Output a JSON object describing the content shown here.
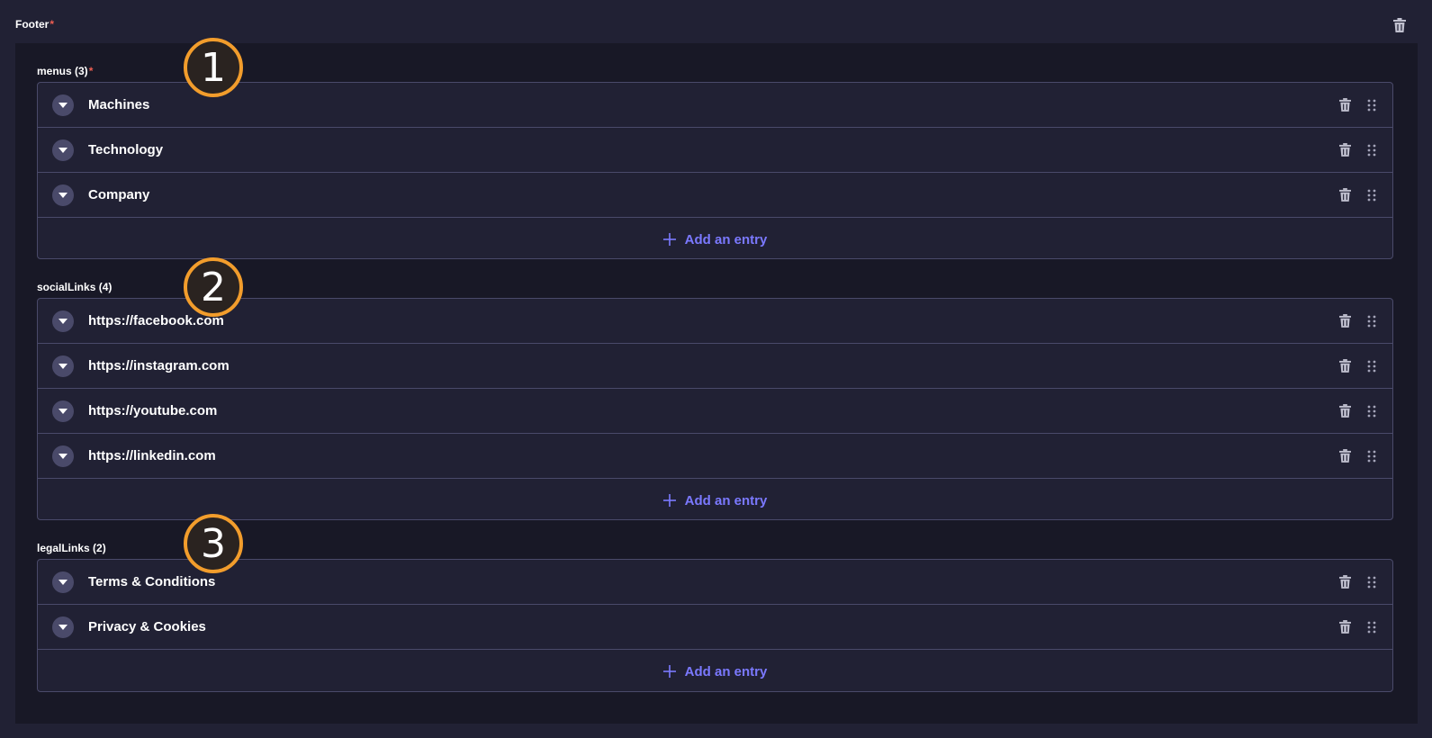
{
  "header": {
    "title": "Footer",
    "required_mark": "*"
  },
  "sections": [
    {
      "label": "menus (3)",
      "required_mark": "*",
      "items": [
        "Machines",
        "Technology",
        "Company"
      ],
      "add_label": "Add an entry"
    },
    {
      "label": "socialLinks (4)",
      "required_mark": "",
      "items": [
        "https://facebook.com",
        "https://instagram.com",
        "https://youtube.com",
        "https://linkedin.com"
      ],
      "add_label": "Add an entry"
    },
    {
      "label": "legalLinks (2)",
      "required_mark": "",
      "items": [
        "Terms & Conditions",
        "Privacy & Cookies"
      ],
      "add_label": "Add an entry"
    }
  ],
  "markers": [
    "1",
    "2",
    "3"
  ],
  "icons": {
    "delete": "trash-icon",
    "drag": "drag-handle-icon",
    "expand": "chevron-down-icon",
    "add": "plus-icon"
  },
  "colors": {
    "background": "#212134",
    "panel": "#181826",
    "border": "#4a4a6a",
    "accent": "#7b79ff",
    "required": "#ee5e52",
    "marker": "#f29d2c"
  }
}
